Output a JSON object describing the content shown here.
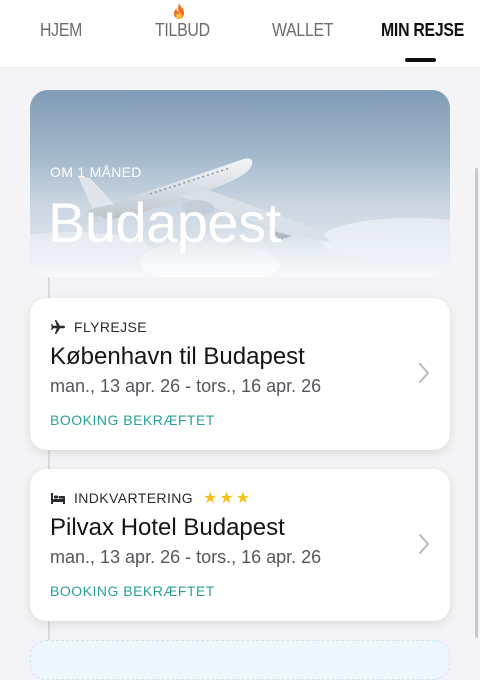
{
  "nav": {
    "tabs": [
      {
        "label": "HJEM"
      },
      {
        "label": "TILBUD",
        "icon": "fire-icon"
      },
      {
        "label": "WALLET"
      },
      {
        "label": "MIN REJSE",
        "active": true
      }
    ]
  },
  "hero": {
    "subtitle": "OM 1 MÅNED",
    "title": "Budapest"
  },
  "cards": [
    {
      "icon": "airplane-icon",
      "label": "FLYREJSE",
      "title": "København til Budapest",
      "dates": "man., 13 apr. 26 - tors., 16 apr. 26",
      "status": "BOOKING BEKRÆFTET"
    },
    {
      "icon": "bed-icon",
      "label": "INDKVARTERING",
      "stars": "★★★",
      "star_rating": 3,
      "title": "Pilvax Hotel Budapest",
      "dates": "man., 13 apr. 26 - tors., 16 apr. 26",
      "status": "BOOKING BEKRÆFTET"
    }
  ],
  "colors": {
    "accent_status": "#2aa198",
    "star": "#f4c01c",
    "active_tab": "#111111",
    "inactive_tab": "#6b6b70"
  }
}
